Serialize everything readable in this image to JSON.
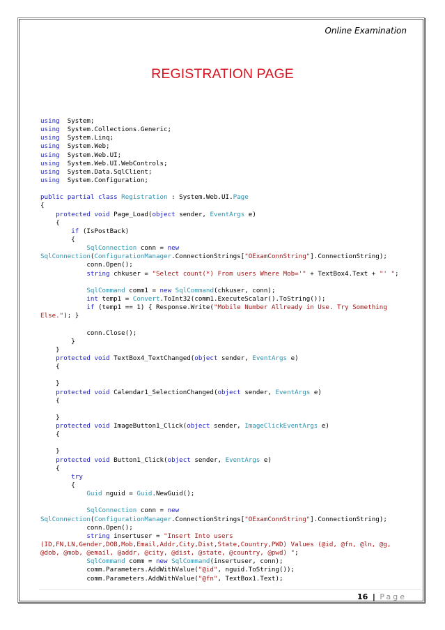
{
  "document": {
    "header": "Online Examination",
    "title": "REGISTRATION PAGE",
    "footer": {
      "page_number": "16",
      "separator": "|",
      "page_label": "Page"
    },
    "colors": {
      "title": "#d9141e",
      "keyword": "#1e22c8",
      "type": "#2b91af",
      "string": "#a31515",
      "text": "#000000"
    },
    "code_lines": [
      [
        [
          "kw",
          "using"
        ],
        [
          "",
          "  System;"
        ]
      ],
      [
        [
          "kw",
          "using"
        ],
        [
          "",
          "  System.Collections.Generic;"
        ]
      ],
      [
        [
          "kw",
          "using"
        ],
        [
          "",
          "  System.Linq;"
        ]
      ],
      [
        [
          "kw",
          "using"
        ],
        [
          "",
          "  System.Web;"
        ]
      ],
      [
        [
          "kw",
          "using"
        ],
        [
          "",
          "  System.Web.UI;"
        ]
      ],
      [
        [
          "kw",
          "using"
        ],
        [
          "",
          "  System.Web.UI.WebControls;"
        ]
      ],
      [
        [
          "kw",
          "using"
        ],
        [
          "",
          "  System.Data.SqlClient;"
        ]
      ],
      [
        [
          "kw",
          "using"
        ],
        [
          "",
          "  System.Configuration;"
        ]
      ],
      [],
      [
        [
          "kw",
          "public partial class"
        ],
        [
          "ty",
          " Registration"
        ],
        [
          "",
          " : System.Web.UI."
        ],
        [
          "ty",
          "Page"
        ]
      ],
      [
        [
          "",
          "{"
        ]
      ],
      [
        [
          "",
          "    "
        ],
        [
          "kw",
          "protected void"
        ],
        [
          "",
          " Page_Load("
        ],
        [
          "kw",
          "object"
        ],
        [
          "",
          " sender, "
        ],
        [
          "ty",
          "EventArgs"
        ],
        [
          "",
          " e)"
        ]
      ],
      [
        [
          "",
          "    {"
        ]
      ],
      [
        [
          "",
          "        "
        ],
        [
          "kw",
          "if"
        ],
        [
          "",
          " (IsPostBack)"
        ]
      ],
      [
        [
          "",
          "        {"
        ]
      ],
      [
        [
          "",
          "            "
        ],
        [
          "ty",
          "SqlConnection"
        ],
        [
          "",
          " conn = "
        ],
        [
          "kw",
          "new"
        ]
      ],
      [
        [
          "ty",
          "SqlConnection"
        ],
        [
          "",
          "("
        ],
        [
          "ty",
          "ConfigurationManager"
        ],
        [
          "",
          ".ConnectionStrings["
        ],
        [
          "st",
          "\"OExamConnString\""
        ],
        [
          "",
          "].ConnectionString);"
        ]
      ],
      [
        [
          "",
          "            conn.Open();"
        ]
      ],
      [
        [
          "",
          "            "
        ],
        [
          "kw",
          "string"
        ],
        [
          "",
          " chkuser = "
        ],
        [
          "st",
          "\"Select count(*) From users Where Mob='\""
        ],
        [
          "",
          " + TextBox4.Text + "
        ],
        [
          "st",
          "\"' \""
        ],
        [
          "",
          ";"
        ]
      ],
      [],
      [
        [
          "",
          "            "
        ],
        [
          "ty",
          "SqlCommand"
        ],
        [
          "",
          " comm1 = "
        ],
        [
          "kw",
          "new"
        ],
        [
          "ty",
          " SqlCommand"
        ],
        [
          "",
          "(chkuser, conn);"
        ]
      ],
      [
        [
          "",
          "            "
        ],
        [
          "kw",
          "int"
        ],
        [
          "",
          " temp1 = "
        ],
        [
          "ty",
          "Convert"
        ],
        [
          "",
          ".ToInt32(comm1.ExecuteScalar().ToString());"
        ]
      ],
      [
        [
          "",
          "            "
        ],
        [
          "kw",
          "if"
        ],
        [
          "",
          " (temp1 == 1) { Response.Write("
        ],
        [
          "st",
          "\"Mobile Number Allready in Use. Try Something"
        ]
      ],
      [
        [
          "st",
          "Else.\""
        ],
        [
          "",
          "); }"
        ]
      ],
      [],
      [
        [
          "",
          "            conn.Close();"
        ]
      ],
      [
        [
          "",
          "        }"
        ]
      ],
      [
        [
          "",
          "    }"
        ]
      ],
      [
        [
          "",
          "    "
        ],
        [
          "kw",
          "protected void"
        ],
        [
          "",
          " TextBox4_TextChanged("
        ],
        [
          "kw",
          "object"
        ],
        [
          "",
          " sender, "
        ],
        [
          "ty",
          "EventArgs"
        ],
        [
          "",
          " e)"
        ]
      ],
      [
        [
          "",
          "    {"
        ]
      ],
      [],
      [
        [
          "",
          "    }"
        ]
      ],
      [
        [
          "",
          "    "
        ],
        [
          "kw",
          "protected void"
        ],
        [
          "",
          " Calendar1_SelectionChanged("
        ],
        [
          "kw",
          "object"
        ],
        [
          "",
          " sender, "
        ],
        [
          "ty",
          "EventArgs"
        ],
        [
          "",
          " e)"
        ]
      ],
      [
        [
          "",
          "    {"
        ]
      ],
      [],
      [
        [
          "",
          "    }"
        ]
      ],
      [
        [
          "",
          "    "
        ],
        [
          "kw",
          "protected void"
        ],
        [
          "",
          " ImageButton1_Click("
        ],
        [
          "kw",
          "object"
        ],
        [
          "",
          " sender, "
        ],
        [
          "ty",
          "ImageClickEventArgs"
        ],
        [
          "",
          " e)"
        ]
      ],
      [
        [
          "",
          "    {"
        ]
      ],
      [],
      [
        [
          "",
          "    }"
        ]
      ],
      [
        [
          "",
          "    "
        ],
        [
          "kw",
          "protected void"
        ],
        [
          "",
          " Button1_Click("
        ],
        [
          "kw",
          "object"
        ],
        [
          "",
          " sender, "
        ],
        [
          "ty",
          "EventArgs"
        ],
        [
          "",
          " e)"
        ]
      ],
      [
        [
          "",
          "    {"
        ]
      ],
      [
        [
          "",
          "        "
        ],
        [
          "kw",
          "try"
        ]
      ],
      [
        [
          "",
          "        {"
        ]
      ],
      [
        [
          "",
          "            "
        ],
        [
          "ty",
          "Guid"
        ],
        [
          "",
          " nguid = "
        ],
        [
          "ty",
          "Guid"
        ],
        [
          "",
          ".NewGuid();"
        ]
      ],
      [],
      [
        [
          "",
          "            "
        ],
        [
          "ty",
          "SqlConnection"
        ],
        [
          "",
          " conn = "
        ],
        [
          "kw",
          "new"
        ]
      ],
      [
        [
          "ty",
          "SqlConnection"
        ],
        [
          "",
          "("
        ],
        [
          "ty",
          "ConfigurationManager"
        ],
        [
          "",
          ".ConnectionStrings["
        ],
        [
          "st",
          "\"OExamConnString\""
        ],
        [
          "",
          "].ConnectionString);"
        ]
      ],
      [
        [
          "",
          "            conn.Open();"
        ]
      ],
      [
        [
          "",
          "            "
        ],
        [
          "kw",
          "string"
        ],
        [
          "",
          " insertuser = "
        ],
        [
          "st",
          "\"Insert Into users"
        ]
      ],
      [
        [
          "st",
          "(ID,FN,LN,Gender,DOB,Mob,Email,Addr,City,Dist,State,Country,PWD) Values (@id, @fn, @ln, @g,"
        ]
      ],
      [
        [
          "st",
          "@dob, @mob, @email, @addr, @city, @dist, @state, @country, @pwd) \""
        ],
        [
          "",
          ";"
        ]
      ],
      [
        [
          "",
          "            "
        ],
        [
          "ty",
          "SqlCommand"
        ],
        [
          "",
          " comm = "
        ],
        [
          "kw",
          "new"
        ],
        [
          "ty",
          " SqlCommand"
        ],
        [
          "",
          "(insertuser, conn);"
        ]
      ],
      [
        [
          "",
          "            comm.Parameters.AddWithValue("
        ],
        [
          "st",
          "\"@id\""
        ],
        [
          "",
          ", nguid.ToString());"
        ]
      ],
      [
        [
          "",
          "            comm.Parameters.AddWithValue("
        ],
        [
          "st",
          "\"@fn\""
        ],
        [
          "",
          ", TextBox1.Text);"
        ]
      ]
    ]
  }
}
